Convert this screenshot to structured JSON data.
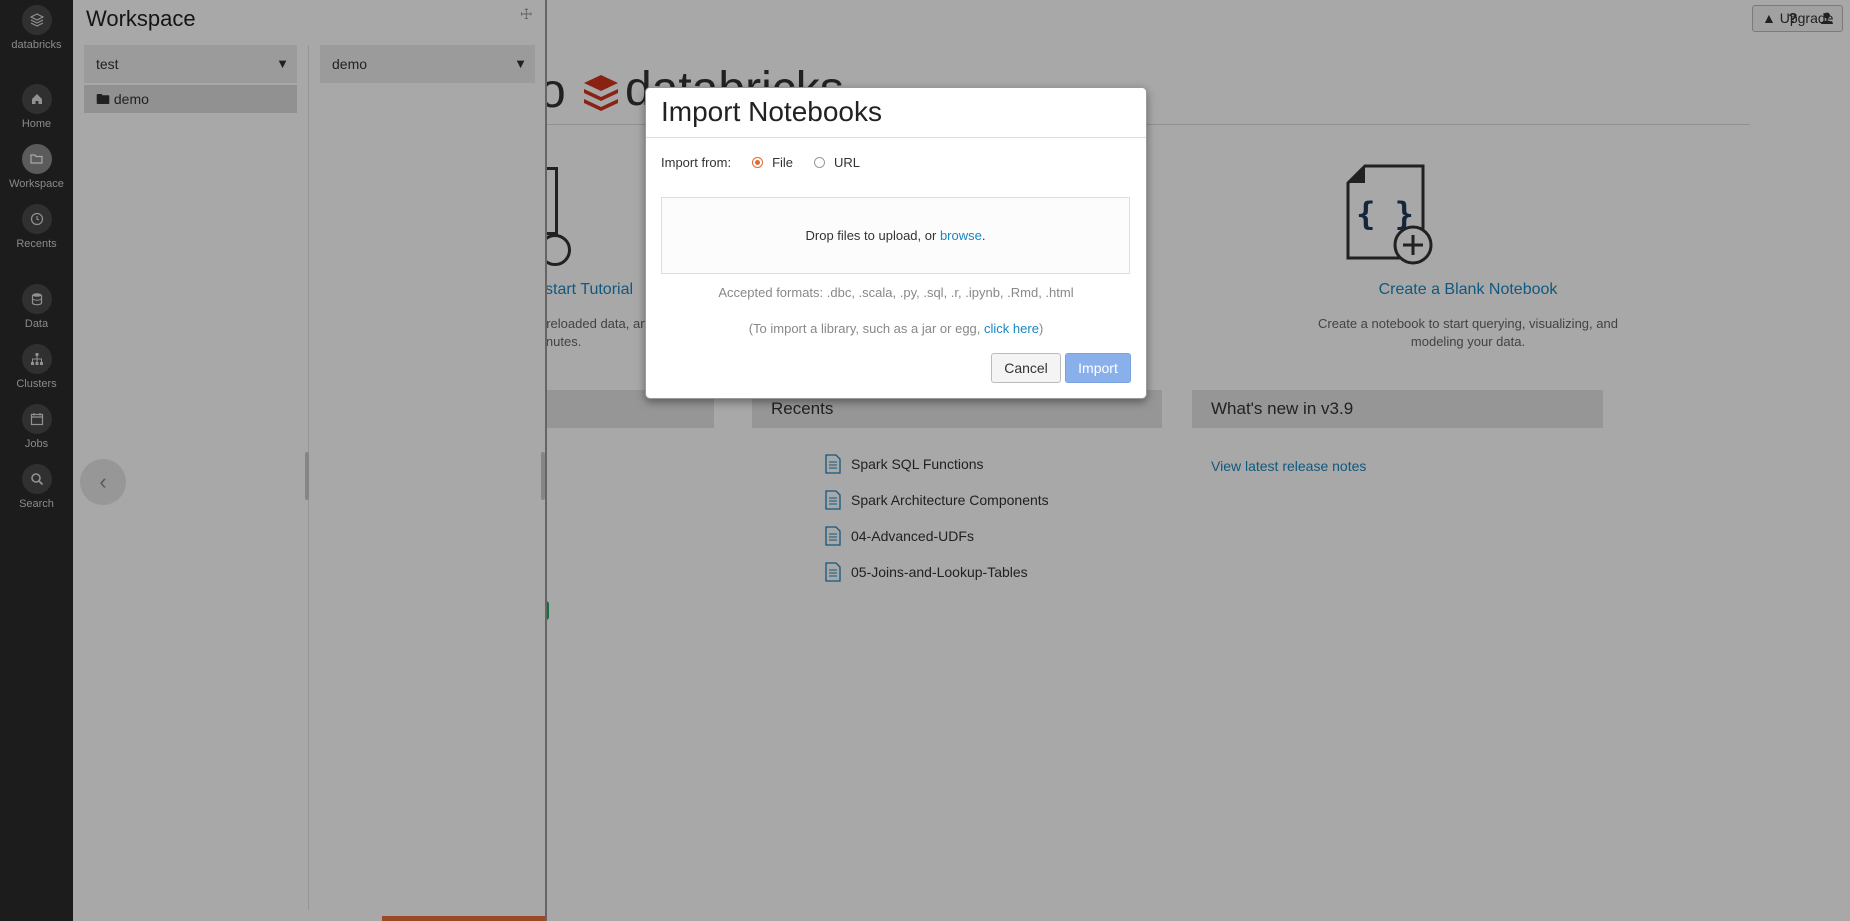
{
  "nav": {
    "brand": "databricks",
    "items": [
      {
        "label": "Home",
        "icon": "home-icon"
      },
      {
        "label": "Workspace",
        "icon": "folder-icon"
      },
      {
        "label": "Recents",
        "icon": "clock-icon"
      },
      {
        "label": "Data",
        "icon": "database-icon"
      },
      {
        "label": "Clusters",
        "icon": "cluster-icon"
      },
      {
        "label": "Jobs",
        "icon": "calendar-icon"
      },
      {
        "label": "Search",
        "icon": "search-icon"
      }
    ]
  },
  "header": {
    "upgrade_label": "Upgrade",
    "help_label": "?"
  },
  "welcome": {
    "tutorial_link": "start Tutorial",
    "tutorial_desc_1": "preloaded data, an",
    "tutorial_desc_2": "inutes.",
    "blank_notebook_title": "Create a Blank Notebook",
    "blank_notebook_desc_1": "Create a notebook to start querying, visualizing, and",
    "blank_notebook_desc_2": "modeling your data.",
    "notebook_glyph": "{ }"
  },
  "recents": {
    "title": "Recents",
    "items": [
      "Spark SQL Functions",
      "Spark Architecture Components",
      "04-Advanced-UDFs",
      "05-Joins-and-Lookup-Tables"
    ]
  },
  "whats_new": {
    "title": "What's new in v3.9",
    "link": "View latest release notes"
  },
  "workspace": {
    "title": "Workspace",
    "column1_select": "test",
    "column2_select": "demo",
    "items": [
      "demo"
    ]
  },
  "modal": {
    "title": "Import Notebooks",
    "import_from_label": "Import from:",
    "options": [
      "File",
      "URL"
    ],
    "selected_option": "File",
    "drop_text": "Drop files to upload, or",
    "browse_link": "browse",
    "drop_suffix": ".",
    "accepted_formats": "Accepted formats: .dbc, .scala, .py, .sql, .r, .ipynb, .Rmd, .html",
    "library_prefix": "(To import a library, such as a jar or egg,",
    "library_link": "click here",
    "library_suffix": ")",
    "cancel_label": "Cancel",
    "import_label": "Import"
  },
  "colors": {
    "accent": "#1a87c1",
    "brand_red": "#d2341f",
    "nav_bg": "#2b2b2b",
    "radio_selected": "#e06a3a",
    "import_button": "#8ab0ec"
  }
}
